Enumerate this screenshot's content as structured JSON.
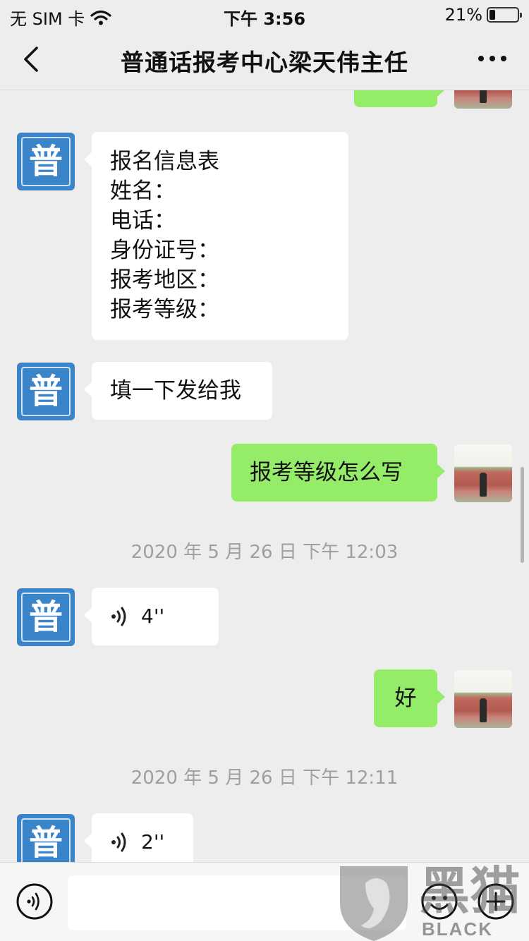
{
  "status_bar": {
    "carrier": "无 SIM 卡",
    "time": "下午 3:56",
    "battery": "21%",
    "battery_level": 0.21
  },
  "header": {
    "back_icon": "chevron-left-icon",
    "title": "普通话报考中心梁天伟主任",
    "more_icon": "more-dots-icon"
  },
  "contact": {
    "avatar_char": "普",
    "avatar_color": "#3a84c9"
  },
  "messages": {
    "form": {
      "lines": [
        "报名信息表",
        "姓名：",
        "电话：",
        "身份证号：",
        "报考地区：",
        "报考等级："
      ]
    },
    "fill_in": "填一下发给我",
    "question": "报考等级怎么写",
    "timestamp_1": "2020 年 5 月 26 日  下午 12:03",
    "voice_1": "4''",
    "reply_ok": "好",
    "timestamp_2": "2020 年 5 月 26 日  下午 12:11",
    "voice_2": "2''"
  },
  "input_bar": {
    "voice_icon": "voice-input-icon",
    "emoji_icon": "emoji-icon",
    "plus_icon": "plus-icon",
    "text_value": ""
  },
  "watermark": {
    "text": "BLACK CAT",
    "logo_text": "黑猫"
  },
  "colors": {
    "background": "#ededed",
    "outgoing_bubble": "#95ec69",
    "incoming_bubble": "#ffffff",
    "timestamp_text": "#9f9f9f"
  }
}
